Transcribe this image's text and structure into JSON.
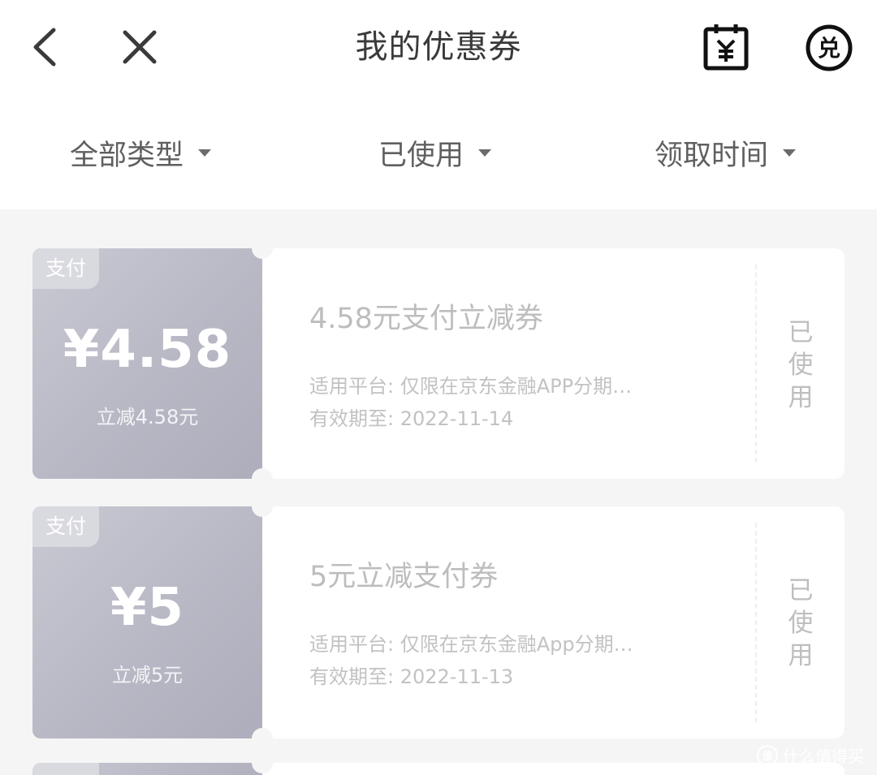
{
  "header": {
    "title": "我的优惠券",
    "icons": {
      "back": "chevron-left-icon",
      "close": "close-icon",
      "bill": "yuan-bill-icon",
      "redeem": "redeem-icon"
    },
    "redeem_glyph": "兑",
    "bill_glyph": "¥"
  },
  "filters": [
    {
      "label": "全部类型"
    },
    {
      "label": "已使用"
    },
    {
      "label": "领取时间"
    }
  ],
  "coupons": [
    {
      "tag": "支付",
      "amount": "¥4.58",
      "sub": "立减4.58元",
      "title": "4.58元支付立减券",
      "platform": "适用平台: 仅限在京东金融APP分期…",
      "expiry": "有效期至: 2022-11-14",
      "status": "已使用"
    },
    {
      "tag": "支付",
      "amount": "¥5",
      "sub": "立减5元",
      "title": "5元立减支付券",
      "platform": "适用平台: 仅限在京东金融App分期…",
      "expiry": "有效期至: 2022-11-13",
      "status": "已使用"
    }
  ],
  "watermark": {
    "text": "什么值得买",
    "logo": "值"
  },
  "colors": {
    "stub_gradient_start": "#c9c9d3",
    "stub_gradient_end": "#adadbb",
    "page_bg": "#f5f5f6",
    "muted_text": "#bdbdbd"
  }
}
